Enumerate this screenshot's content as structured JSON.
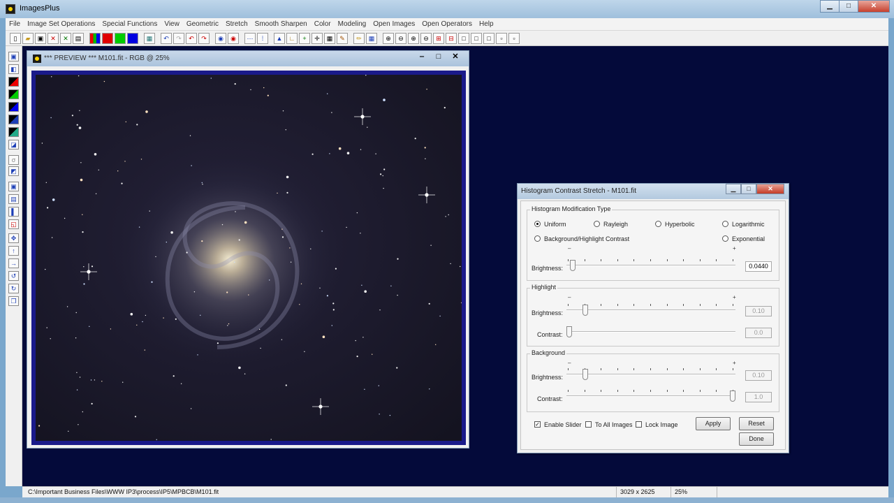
{
  "window": {
    "title": "ImagesPlus"
  },
  "menu": [
    "File",
    "Image Set Operations",
    "Special Functions",
    "View",
    "Geometric",
    "Stretch",
    "Smooth Sharpen",
    "Color",
    "Modeling",
    "Open Images",
    "Open Operators",
    "Help"
  ],
  "preview": {
    "title": "*** PREVIEW *** M101.fit - RGB @ 25%"
  },
  "dialog": {
    "title": "Histogram Contrast Stretch - M101.fit",
    "mod_group": "Histogram Modification Type",
    "types": {
      "uniform": "Uniform",
      "rayleigh": "Rayleigh",
      "hyperbolic": "Hyperbolic",
      "logarithmic": "Logarithmic",
      "bg_highlight": "Background/Highlight Contrast",
      "exponential": "Exponential"
    },
    "selected_type": "Uniform",
    "brightness_label": "Brightness:",
    "contrast_label": "Contrast:",
    "minus": "–",
    "plus": "+",
    "main_brightness": {
      "value": "0.0440",
      "level": 0.02
    },
    "highlight": {
      "label": "Highlight",
      "brightness": {
        "value": "0.10",
        "level": 0.1
      },
      "contrast": {
        "value": "0.0",
        "level": 0.0
      }
    },
    "background": {
      "label": "Background",
      "brightness": {
        "value": "0.10",
        "level": 0.1
      },
      "contrast": {
        "value": "1.0",
        "level": 1.0
      }
    },
    "options": {
      "enable_slider": {
        "label": "Enable Slider",
        "checked": true
      },
      "to_all_images": {
        "label": "To All Images",
        "checked": false
      },
      "lock_image": {
        "label": "Lock Image",
        "checked": false
      }
    },
    "buttons": {
      "apply": "Apply",
      "reset": "Reset",
      "done": "Done"
    }
  },
  "status": {
    "path": "C:\\Important Business Files\\WWW IP3\\process\\IP5\\MPBCB\\M101.fit",
    "dimensions": "3029 x 2625",
    "zoom": "25%"
  },
  "colors": {
    "workspace": "#040a3a",
    "frame_blue": "#1a1a8a",
    "sky": "#12121f"
  },
  "icons": {
    "toolbar": [
      "new-file-icon",
      "open-folder-icon",
      "save-icon",
      "close-icon",
      "clear-icon",
      "print-icon",
      "rgb-channels-icon",
      "red-channel-icon",
      "green-channel-icon",
      "blue-channel-icon",
      "grid-icon",
      "undo-icon",
      "redo-icon",
      "undo-all-icon",
      "redo-all-icon",
      "target-icon",
      "record-icon",
      "dots-icon",
      "sort-icon",
      "histogram-icon",
      "curve-icon",
      "plus-icon",
      "crosshair-icon",
      "calculator-icon",
      "palette-icon",
      "pencil-icon",
      "table-icon",
      "zoom-fit-icon",
      "zoom-out-icon",
      "zoom-in-icon",
      "zoom-actual-icon",
      "add-frame-icon",
      "remove-frame-icon",
      "frame-1-icon",
      "frame-2-icon",
      "frame-3-icon",
      "frame-4-icon",
      "frame-5-icon"
    ]
  }
}
